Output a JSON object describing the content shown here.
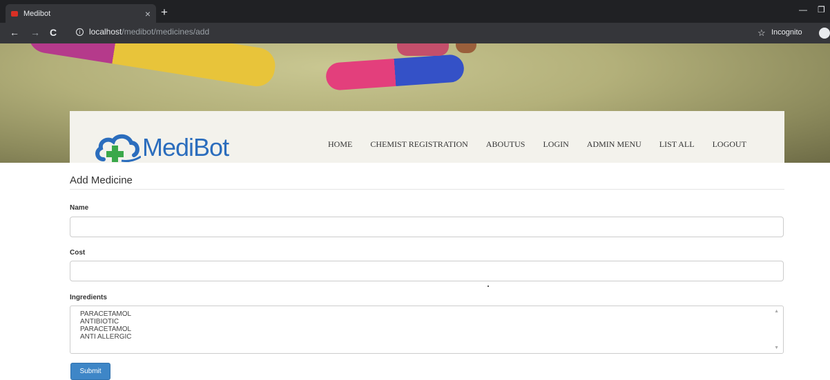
{
  "browser": {
    "tab_title": "Medibot",
    "tab_close": "×",
    "new_tab": "+",
    "url_host": "localhost",
    "url_path": "/medibot/medicines/add",
    "incognito_label": "Incognito",
    "back": "←",
    "forward": "→",
    "reload": "C",
    "bookmark": "☆",
    "minimize": "—",
    "restore": "❐"
  },
  "header": {
    "logo_text": "MediBot",
    "nav": [
      "HOME",
      "CHEMIST REGISTRATION",
      "ABOUTUS",
      "LOGIN",
      "ADMIN MENU",
      "LIST ALL",
      "LOGOUT"
    ]
  },
  "form": {
    "title": "Add Medicine",
    "name_label": "Name",
    "name_value": "",
    "cost_label": "Cost",
    "cost_value": "",
    "ingredients_label": "Ingredients",
    "ingredients": [
      "PARACETAMOL",
      "ANTIBIOTIC",
      "PARACETAMOL",
      "ANTI ALLERGIC"
    ],
    "submit_label": "Submit"
  },
  "colors": {
    "brand": "#2b6dbd",
    "primary_button": "#3e86c7",
    "browser_dark": "#202124"
  }
}
